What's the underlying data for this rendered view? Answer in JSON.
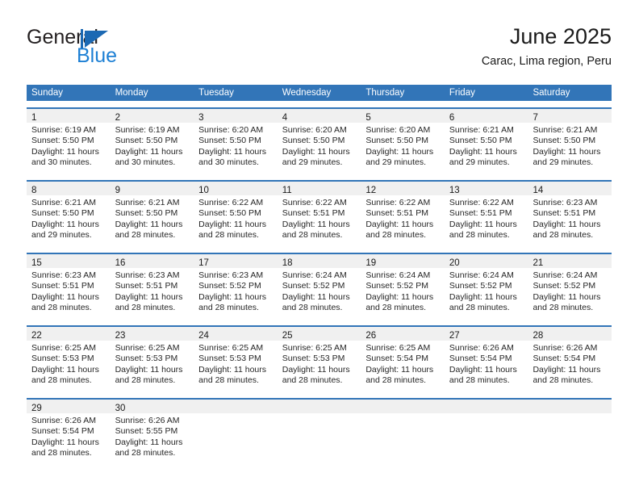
{
  "brand": {
    "name_top": "General",
    "name_bottom": "Blue",
    "mark": "triangle-logo",
    "color_primary": "#1c69b3",
    "color_secondary": "#1c7fd4"
  },
  "header": {
    "title": "June 2025",
    "subtitle": "Carac, Lima region, Peru"
  },
  "calendar": {
    "header_bg": "#3275b8",
    "day_band_bg": "#f0f0f0",
    "weekdays": [
      "Sunday",
      "Monday",
      "Tuesday",
      "Wednesday",
      "Thursday",
      "Friday",
      "Saturday"
    ],
    "weeks": [
      [
        {
          "day": "1",
          "sunrise": "Sunrise: 6:19 AM",
          "sunset": "Sunset: 5:50 PM",
          "daylight_line1": "Daylight: 11 hours",
          "daylight_line2": "and 30 minutes."
        },
        {
          "day": "2",
          "sunrise": "Sunrise: 6:19 AM",
          "sunset": "Sunset: 5:50 PM",
          "daylight_line1": "Daylight: 11 hours",
          "daylight_line2": "and 30 minutes."
        },
        {
          "day": "3",
          "sunrise": "Sunrise: 6:20 AM",
          "sunset": "Sunset: 5:50 PM",
          "daylight_line1": "Daylight: 11 hours",
          "daylight_line2": "and 30 minutes."
        },
        {
          "day": "4",
          "sunrise": "Sunrise: 6:20 AM",
          "sunset": "Sunset: 5:50 PM",
          "daylight_line1": "Daylight: 11 hours",
          "daylight_line2": "and 29 minutes."
        },
        {
          "day": "5",
          "sunrise": "Sunrise: 6:20 AM",
          "sunset": "Sunset: 5:50 PM",
          "daylight_line1": "Daylight: 11 hours",
          "daylight_line2": "and 29 minutes."
        },
        {
          "day": "6",
          "sunrise": "Sunrise: 6:21 AM",
          "sunset": "Sunset: 5:50 PM",
          "daylight_line1": "Daylight: 11 hours",
          "daylight_line2": "and 29 minutes."
        },
        {
          "day": "7",
          "sunrise": "Sunrise: 6:21 AM",
          "sunset": "Sunset: 5:50 PM",
          "daylight_line1": "Daylight: 11 hours",
          "daylight_line2": "and 29 minutes."
        }
      ],
      [
        {
          "day": "8",
          "sunrise": "Sunrise: 6:21 AM",
          "sunset": "Sunset: 5:50 PM",
          "daylight_line1": "Daylight: 11 hours",
          "daylight_line2": "and 29 minutes."
        },
        {
          "day": "9",
          "sunrise": "Sunrise: 6:21 AM",
          "sunset": "Sunset: 5:50 PM",
          "daylight_line1": "Daylight: 11 hours",
          "daylight_line2": "and 28 minutes."
        },
        {
          "day": "10",
          "sunrise": "Sunrise: 6:22 AM",
          "sunset": "Sunset: 5:50 PM",
          "daylight_line1": "Daylight: 11 hours",
          "daylight_line2": "and 28 minutes."
        },
        {
          "day": "11",
          "sunrise": "Sunrise: 6:22 AM",
          "sunset": "Sunset: 5:51 PM",
          "daylight_line1": "Daylight: 11 hours",
          "daylight_line2": "and 28 minutes."
        },
        {
          "day": "12",
          "sunrise": "Sunrise: 6:22 AM",
          "sunset": "Sunset: 5:51 PM",
          "daylight_line1": "Daylight: 11 hours",
          "daylight_line2": "and 28 minutes."
        },
        {
          "day": "13",
          "sunrise": "Sunrise: 6:22 AM",
          "sunset": "Sunset: 5:51 PM",
          "daylight_line1": "Daylight: 11 hours",
          "daylight_line2": "and 28 minutes."
        },
        {
          "day": "14",
          "sunrise": "Sunrise: 6:23 AM",
          "sunset": "Sunset: 5:51 PM",
          "daylight_line1": "Daylight: 11 hours",
          "daylight_line2": "and 28 minutes."
        }
      ],
      [
        {
          "day": "15",
          "sunrise": "Sunrise: 6:23 AM",
          "sunset": "Sunset: 5:51 PM",
          "daylight_line1": "Daylight: 11 hours",
          "daylight_line2": "and 28 minutes."
        },
        {
          "day": "16",
          "sunrise": "Sunrise: 6:23 AM",
          "sunset": "Sunset: 5:51 PM",
          "daylight_line1": "Daylight: 11 hours",
          "daylight_line2": "and 28 minutes."
        },
        {
          "day": "17",
          "sunrise": "Sunrise: 6:23 AM",
          "sunset": "Sunset: 5:52 PM",
          "daylight_line1": "Daylight: 11 hours",
          "daylight_line2": "and 28 minutes."
        },
        {
          "day": "18",
          "sunrise": "Sunrise: 6:24 AM",
          "sunset": "Sunset: 5:52 PM",
          "daylight_line1": "Daylight: 11 hours",
          "daylight_line2": "and 28 minutes."
        },
        {
          "day": "19",
          "sunrise": "Sunrise: 6:24 AM",
          "sunset": "Sunset: 5:52 PM",
          "daylight_line1": "Daylight: 11 hours",
          "daylight_line2": "and 28 minutes."
        },
        {
          "day": "20",
          "sunrise": "Sunrise: 6:24 AM",
          "sunset": "Sunset: 5:52 PM",
          "daylight_line1": "Daylight: 11 hours",
          "daylight_line2": "and 28 minutes."
        },
        {
          "day": "21",
          "sunrise": "Sunrise: 6:24 AM",
          "sunset": "Sunset: 5:52 PM",
          "daylight_line1": "Daylight: 11 hours",
          "daylight_line2": "and 28 minutes."
        }
      ],
      [
        {
          "day": "22",
          "sunrise": "Sunrise: 6:25 AM",
          "sunset": "Sunset: 5:53 PM",
          "daylight_line1": "Daylight: 11 hours",
          "daylight_line2": "and 28 minutes."
        },
        {
          "day": "23",
          "sunrise": "Sunrise: 6:25 AM",
          "sunset": "Sunset: 5:53 PM",
          "daylight_line1": "Daylight: 11 hours",
          "daylight_line2": "and 28 minutes."
        },
        {
          "day": "24",
          "sunrise": "Sunrise: 6:25 AM",
          "sunset": "Sunset: 5:53 PM",
          "daylight_line1": "Daylight: 11 hours",
          "daylight_line2": "and 28 minutes."
        },
        {
          "day": "25",
          "sunrise": "Sunrise: 6:25 AM",
          "sunset": "Sunset: 5:53 PM",
          "daylight_line1": "Daylight: 11 hours",
          "daylight_line2": "and 28 minutes."
        },
        {
          "day": "26",
          "sunrise": "Sunrise: 6:25 AM",
          "sunset": "Sunset: 5:54 PM",
          "daylight_line1": "Daylight: 11 hours",
          "daylight_line2": "and 28 minutes."
        },
        {
          "day": "27",
          "sunrise": "Sunrise: 6:26 AM",
          "sunset": "Sunset: 5:54 PM",
          "daylight_line1": "Daylight: 11 hours",
          "daylight_line2": "and 28 minutes."
        },
        {
          "day": "28",
          "sunrise": "Sunrise: 6:26 AM",
          "sunset": "Sunset: 5:54 PM",
          "daylight_line1": "Daylight: 11 hours",
          "daylight_line2": "and 28 minutes."
        }
      ],
      [
        {
          "day": "29",
          "sunrise": "Sunrise: 6:26 AM",
          "sunset": "Sunset: 5:54 PM",
          "daylight_line1": "Daylight: 11 hours",
          "daylight_line2": "and 28 minutes."
        },
        {
          "day": "30",
          "sunrise": "Sunrise: 6:26 AM",
          "sunset": "Sunset: 5:55 PM",
          "daylight_line1": "Daylight: 11 hours",
          "daylight_line2": "and 28 minutes."
        },
        {
          "day": "",
          "sunrise": "",
          "sunset": "",
          "daylight_line1": "",
          "daylight_line2": ""
        },
        {
          "day": "",
          "sunrise": "",
          "sunset": "",
          "daylight_line1": "",
          "daylight_line2": ""
        },
        {
          "day": "",
          "sunrise": "",
          "sunset": "",
          "daylight_line1": "",
          "daylight_line2": ""
        },
        {
          "day": "",
          "sunrise": "",
          "sunset": "",
          "daylight_line1": "",
          "daylight_line2": ""
        },
        {
          "day": "",
          "sunrise": "",
          "sunset": "",
          "daylight_line1": "",
          "daylight_line2": ""
        }
      ]
    ]
  }
}
